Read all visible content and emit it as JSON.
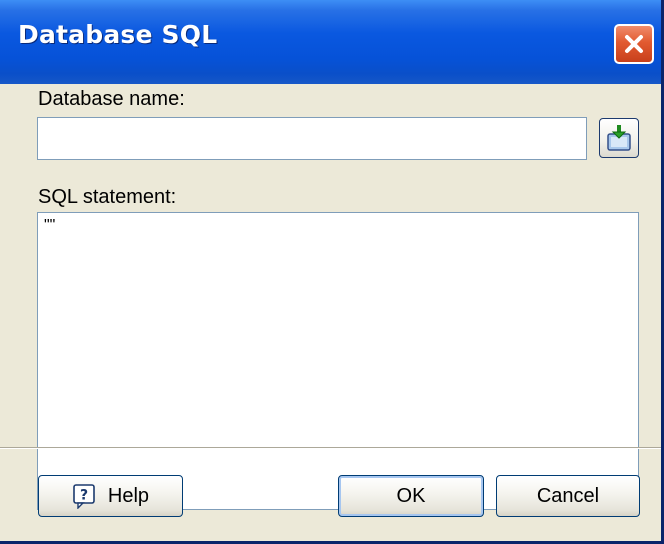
{
  "window": {
    "title": "Database SQL"
  },
  "fields": {
    "database_name_label": "Database name:",
    "database_name_value": "",
    "sql_statement_label": "SQL statement:",
    "sql_statement_value": "\"\""
  },
  "buttons": {
    "help_label": "Help",
    "ok_label": "OK",
    "cancel_label": "Cancel"
  },
  "icons": {
    "close": "close-icon",
    "browse": "database-browse-icon",
    "help": "help-icon"
  },
  "colors": {
    "titlebar": "#0a58e0",
    "close_button": "#e25a30",
    "dialog_background": "#ece9d8",
    "input_border": "#7f9db9"
  }
}
